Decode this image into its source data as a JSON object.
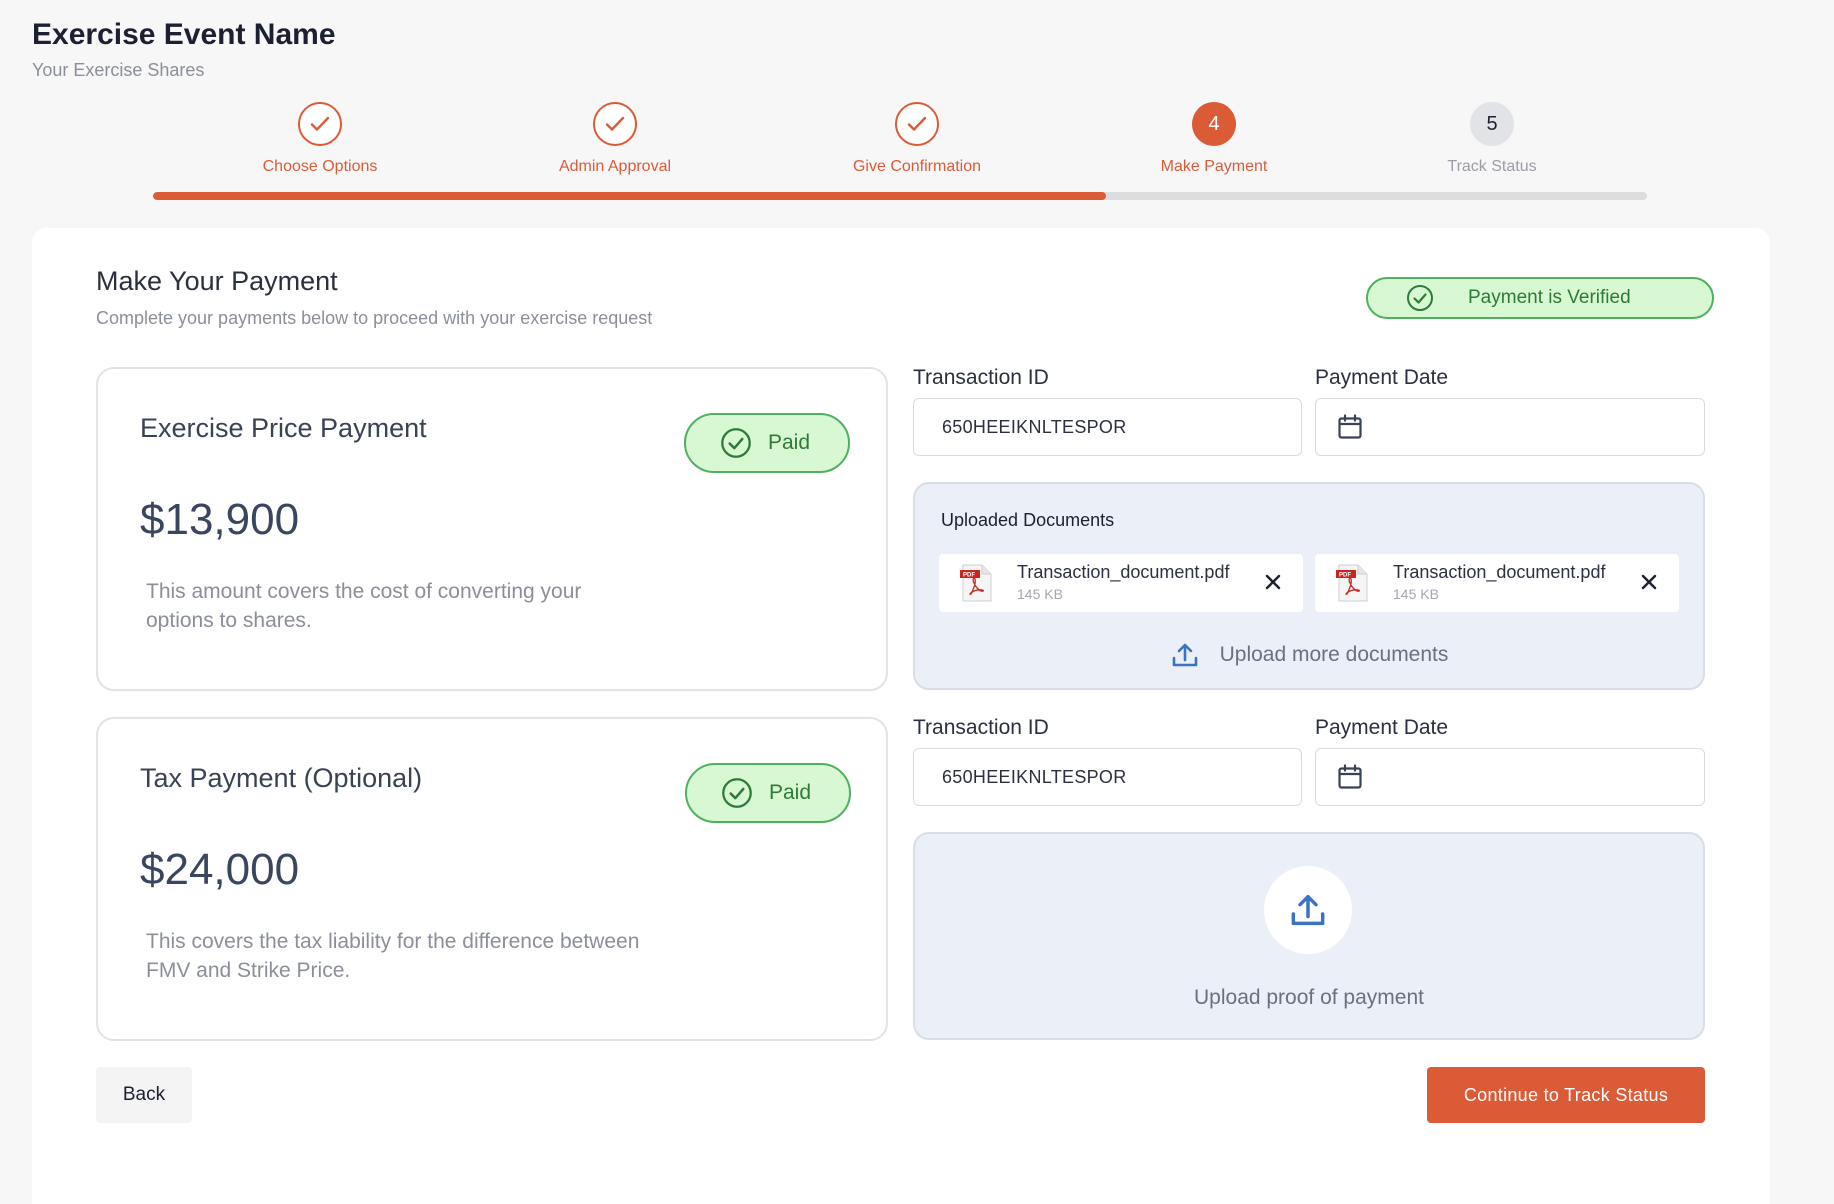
{
  "header": {
    "title": "Exercise Event Name",
    "subtitle": "Your Exercise Shares"
  },
  "stepper": {
    "progress_fraction": 0.638,
    "steps": [
      {
        "label": "Choose Options",
        "state": "done"
      },
      {
        "label": "Admin Approval",
        "state": "done"
      },
      {
        "label": "Give Confirmation",
        "state": "done"
      },
      {
        "label": "Make Payment",
        "state": "active",
        "number": "4"
      },
      {
        "label": "Track Status",
        "state": "pending",
        "number": "5"
      }
    ]
  },
  "section": {
    "title": "Make Your Payment",
    "subtitle": "Complete your payments below to proceed with your exercise request",
    "verified_label": "Payment is Verified"
  },
  "payments": [
    {
      "title": "Exercise Price Payment",
      "status": "Paid",
      "amount": "$13,900",
      "description": "This amount covers the cost of converting your options to shares.",
      "transaction_label": "Transaction ID",
      "transaction_id": "650HEEIKNLTESPOR",
      "date_label": "Payment Date",
      "uploaded_title": "Uploaded Documents",
      "files": [
        {
          "name": "Transaction_document.pdf",
          "size": "145 KB"
        },
        {
          "name": "Transaction_document.pdf",
          "size": "145 KB"
        }
      ],
      "upload_more_label": "Upload more documents"
    },
    {
      "title": "Tax Payment (Optional)",
      "status": "Paid",
      "amount": "$24,000",
      "description": "This covers the tax liability for the difference between FMV and Strike Price.",
      "transaction_label": "Transaction ID",
      "transaction_id": "650HEEIKNLTESPOR",
      "date_label": "Payment Date",
      "upload_proof_label": "Upload proof of payment"
    }
  ],
  "actions": {
    "back": "Back",
    "continue": "Continue to Track Status"
  },
  "colors": {
    "accent": "#dc5b37",
    "success": "#4fb15e",
    "success_bg": "#d8f8d4",
    "upload_bg": "#ebeff7"
  }
}
